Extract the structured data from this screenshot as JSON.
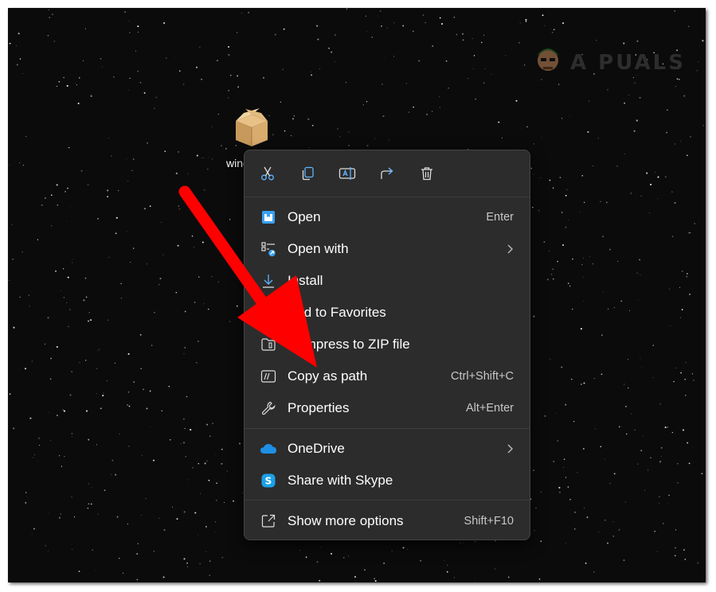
{
  "desktop": {
    "file_label": "wind",
    "watermark_text": "A  PUALS"
  },
  "context_menu": {
    "quick_actions": [
      {
        "name": "cut",
        "icon": "scissors-icon"
      },
      {
        "name": "copy",
        "icon": "copy-icon"
      },
      {
        "name": "rename",
        "icon": "rename-icon"
      },
      {
        "name": "share",
        "icon": "share-icon"
      },
      {
        "name": "delete",
        "icon": "trash-icon"
      }
    ],
    "items": [
      {
        "label": "Open",
        "shortcut": "Enter",
        "icon": "open-package-icon"
      },
      {
        "label": "Open with",
        "shortcut": "",
        "icon": "open-with-icon",
        "submenu": true
      },
      {
        "label": "Install",
        "shortcut": "",
        "icon": "download-icon"
      },
      {
        "label": "Add to Favorites",
        "shortcut": "",
        "icon": "star-icon"
      },
      {
        "label": "Compress to ZIP file",
        "shortcut": "",
        "icon": "zip-folder-icon"
      },
      {
        "label": "Copy as path",
        "shortcut": "Ctrl+Shift+C",
        "icon": "copy-path-icon"
      },
      {
        "label": "Properties",
        "shortcut": "Alt+Enter",
        "icon": "wrench-icon"
      },
      {
        "label": "OneDrive",
        "shortcut": "",
        "icon": "onedrive-icon",
        "submenu": true
      },
      {
        "label": "Share with Skype",
        "shortcut": "",
        "icon": "skype-icon"
      },
      {
        "label": "Show more options",
        "shortcut": "Shift+F10",
        "icon": "more-options-icon"
      }
    ]
  },
  "annotation": {
    "arrow_color": "#ff0000"
  },
  "colors": {
    "menu_bg": "#2c2c2c",
    "accent_blue": "#4cc2ff",
    "desktop_bg": "#0b0b0b"
  }
}
